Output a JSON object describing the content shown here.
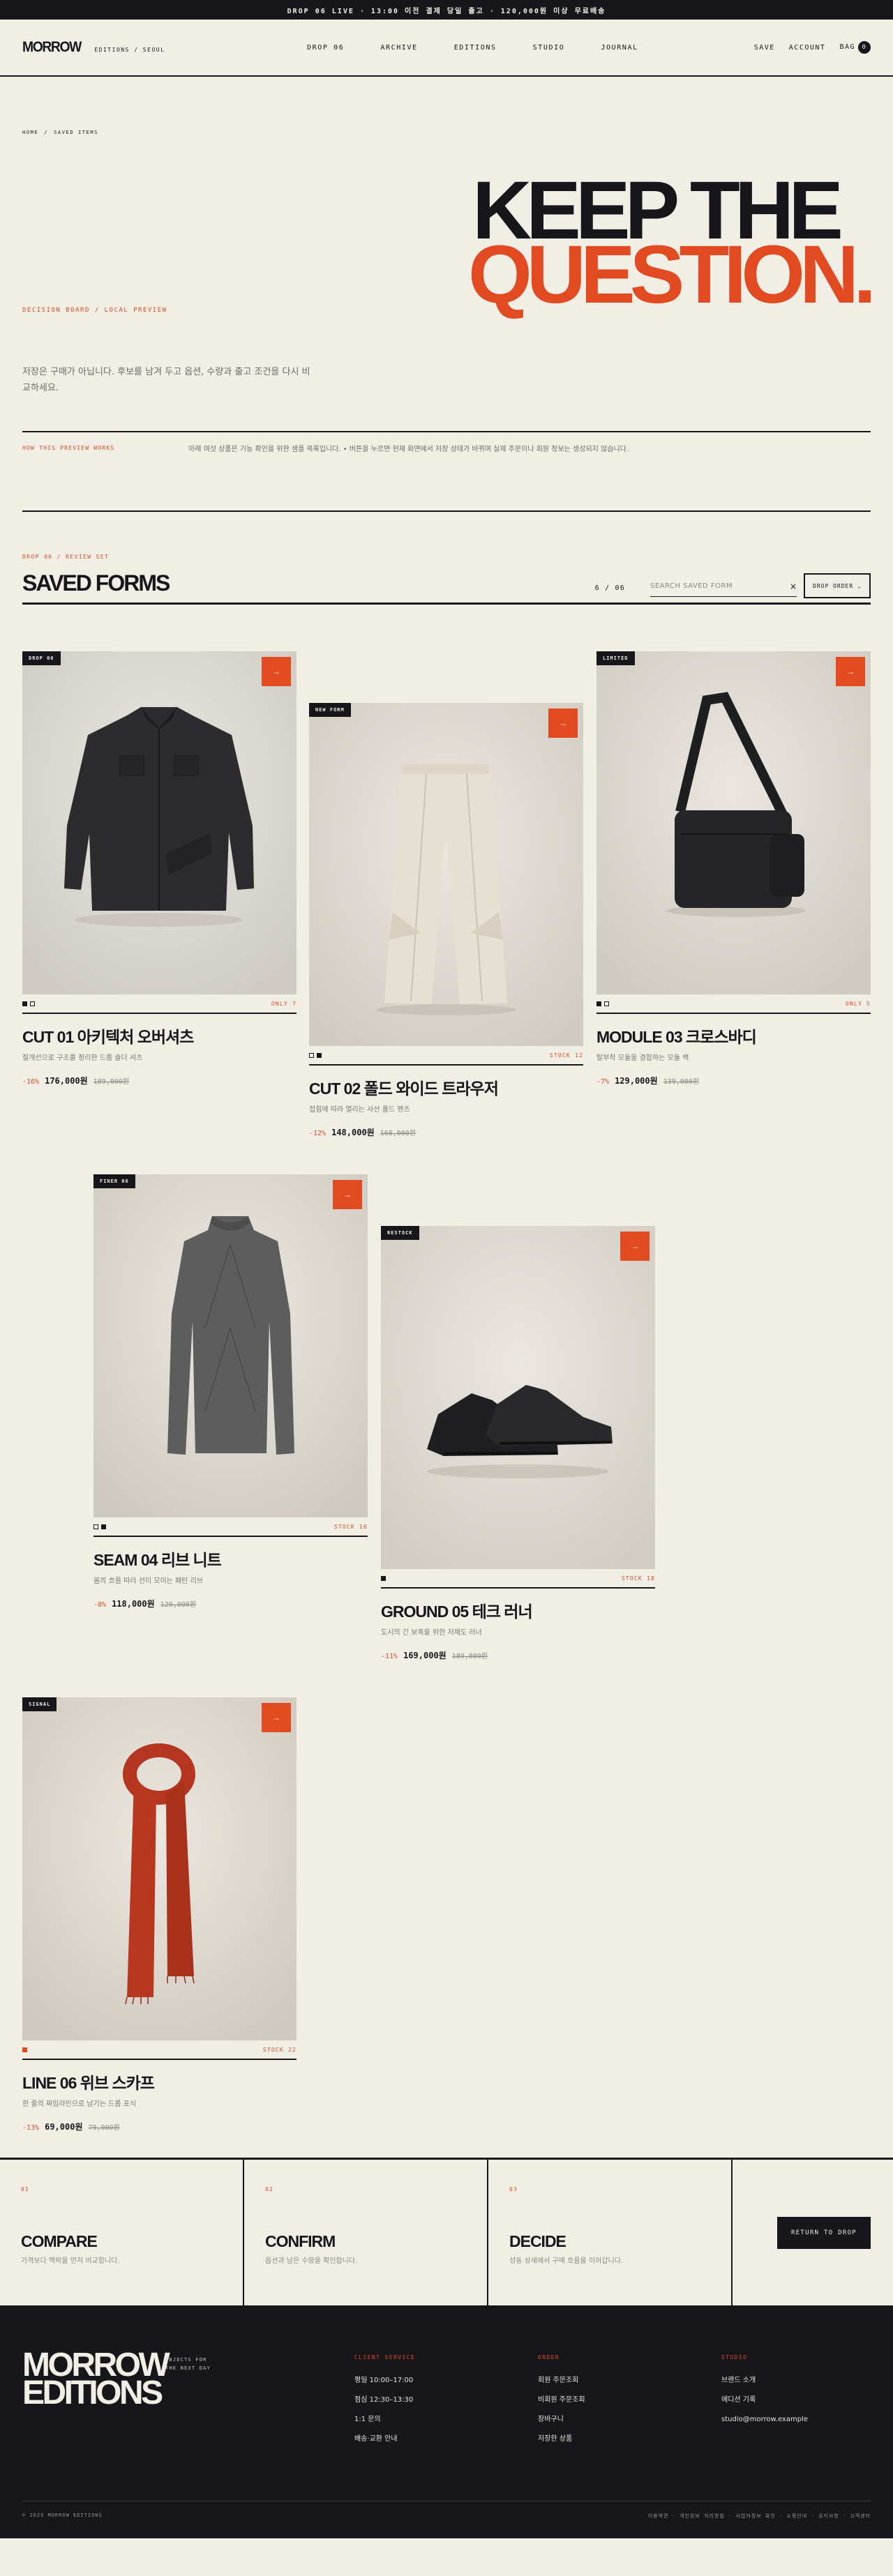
{
  "announcement": "DROP 06 LIVE  ·  13:00 이전 결제 당일 출고  ·  120,000원 이상 무료배송",
  "brand": {
    "name": "MORROW",
    "sub": "EDITIONS / SEOUL"
  },
  "nav": [
    "DROP 06",
    "ARCHIVE",
    "EDITIONS",
    "STUDIO",
    "JOURNAL"
  ],
  "utility": {
    "save": "SAVE",
    "account": "ACCOUNT",
    "bag": "BAG",
    "bag_count": "0"
  },
  "breadcrumb": [
    "HOME",
    "/",
    "SAVED ITEMS"
  ],
  "hero": {
    "title_line1": "KEEP THE",
    "title_line2": "QUESTION.",
    "eyebrow": "DECISION BOARD / LOCAL PREVIEW",
    "description": "저장은 구매가 아닙니다. 후보를 남겨 두고 옵션, 수량과 출고 조건을 다시 비교하세요.",
    "note_label": "HOW THIS PREVIEW WORKS",
    "note": "아래 여섯 상품은 기능 확인을 위한 샘플 목록입니다. • 버튼을 누르면 현재 화면에서 저장 상태가 바뀌며 실제 주문이나 회원 정보는 생성되지 않습니다."
  },
  "toolbar": {
    "drop_label": "DROP 06 / REVIEW SET",
    "title": "SAVED FORMS",
    "count": "6 / 06",
    "search_placeholder": "SEARCH SAVED FORM",
    "clear": "×",
    "sort_label": "DROP ORDER",
    "sort_chevron": "⌄"
  },
  "products": [
    {
      "badge": "DROP 06",
      "quick_add": "→",
      "stock": "ONLY 7",
      "name": "CUT 01 아키텍처 오버셔츠",
      "desc": "절개선으로 구조를 정리한 드롭 숄더 셔츠",
      "discount": "-16%",
      "price": "176,000원",
      "old_price": "189,000원",
      "dots": [
        "active",
        "empty"
      ]
    },
    {
      "badge": "NEW FORM",
      "quick_add": "→",
      "stock": "STOCK 12",
      "name": "CUT 02 폴드 와이드 트라우저",
      "desc": "접힘에 따라 열리는 사선 폴드 팬츠",
      "discount": "-12%",
      "price": "148,000원",
      "old_price": "168,000원",
      "dots": [
        "empty",
        "active"
      ]
    },
    {
      "badge": "LIMITED",
      "quick_add": "→",
      "stock": "ONLY 5",
      "name": "MODULE 03 크로스바디",
      "desc": "탈부착 모듈을 결합하는 모듈 백",
      "discount": "-7%",
      "price": "129,000원",
      "old_price": "139,000원",
      "dots": [
        "active",
        "empty"
      ]
    },
    {
      "badge": "FINER 06",
      "quick_add": "→",
      "stock": "STOCK 16",
      "name": "SEAM 04 리브 니트",
      "desc": "몸의 흐름 따라 선이 모이는 패턴 리브",
      "discount": "-8%",
      "price": "118,000원",
      "old_price": "129,000원",
      "dots": [
        "empty",
        "active"
      ]
    },
    {
      "badge": "RESTOCK",
      "quick_add": "→",
      "stock": "STOCK 18",
      "name": "GROUND 05 테크 러너",
      "desc": "도시의 긴 보폭을 위한 저채도 러너",
      "discount": "-11%",
      "price": "169,000원",
      "old_price": "189,000원",
      "dots": [
        "active"
      ]
    },
    {
      "badge": "SIGNAL",
      "quick_add": "→",
      "stock": "STOCK 22",
      "name": "LINE 06 위브 스카프",
      "desc": "한 줄의 짜임라인으로 남기는 드롭 포식",
      "discount": "-13%",
      "price": "69,000원",
      "old_price": "79,000원",
      "dots": [
        "red"
      ]
    }
  ],
  "steps": [
    {
      "num": "01",
      "title": "COMPARE",
      "desc": "가격보다 맥락을 먼저 비교합니다."
    },
    {
      "num": "02",
      "title": "CONFIRM",
      "desc": "옵션과 남은 수량을 확인합니다."
    },
    {
      "num": "03",
      "title": "DECIDE",
      "desc": "성동 상세에서 구매 흐름을 이어갑니다."
    }
  ],
  "return_button": "RETURN TO DROP",
  "footer": {
    "logo_line1": "MORROW",
    "logo_line2": "EDITIONS",
    "tagline_line1": "OBJECTS FOR",
    "tagline_line2": "THE NEXT DAY",
    "client_head": "CLIENT SERVICE",
    "client_items": [
      "평일 10:00–17:00",
      "점심 12:30–13:30",
      "1:1 문의",
      "배송·교환 안내"
    ],
    "orders_head": "ORDER",
    "orders_items": [
      "회원 주문조회",
      "비회원 주문조회",
      "장바구니",
      "저장한 상품"
    ],
    "studio_head": "STUDIO",
    "studio_items": [
      "브랜드 소개",
      "에디션 기록",
      "studio@morrow.example"
    ],
    "copyright": "© 2025 MORROW EDITIONS",
    "legal": "이용약관 · 개인정보 처리방침 · 사업자정보 확인 · 쇼핑안내 · 공지사항 · 고객센터"
  },
  "colors": {
    "background": "#f1eee5",
    "ink": "#16161b",
    "accent": "#e24a21"
  },
  "icons": [
    "arrow-right-icon",
    "close-icon",
    "chevron-down-icon"
  ]
}
